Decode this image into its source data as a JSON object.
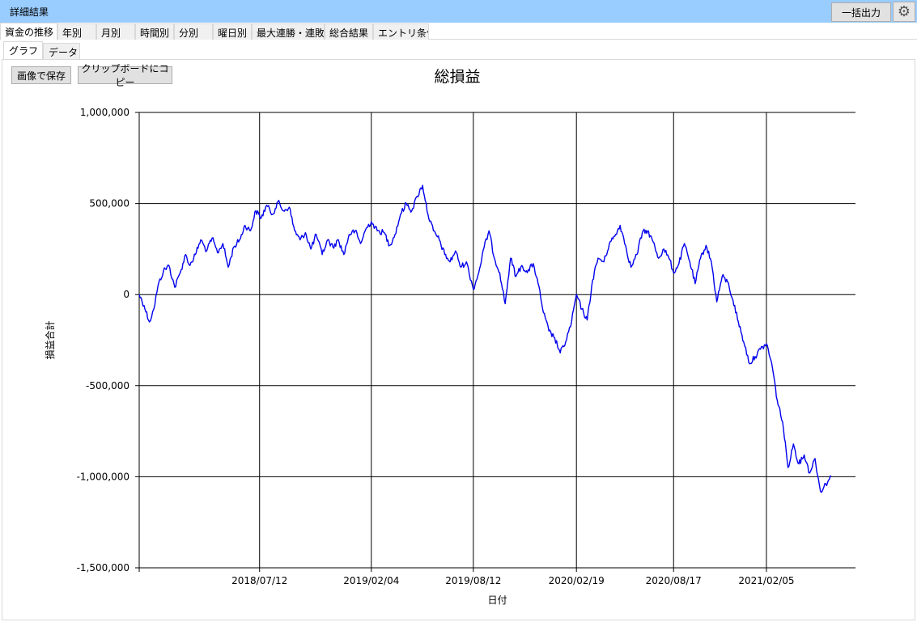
{
  "window": {
    "title": "詳細結果"
  },
  "toolbar": {
    "export_label": "一括出力",
    "settings_icon": "gear-icon"
  },
  "tabs": [
    {
      "label": "資金の推移"
    },
    {
      "label": "年別"
    },
    {
      "label": "月別"
    },
    {
      "label": "時間別"
    },
    {
      "label": "分別"
    },
    {
      "label": "曜日別"
    },
    {
      "label": "最大連勝・連敗"
    },
    {
      "label": "総合結果"
    },
    {
      "label": "エントリ条件"
    }
  ],
  "subtabs": [
    {
      "label": "グラフ"
    },
    {
      "label": "データ"
    }
  ],
  "actions": {
    "save_label": "画像で保存",
    "copy_label": "クリップボードにコピー"
  },
  "colors": {
    "series": "#0000ee",
    "titlebar": "#99ccff"
  },
  "chart_data": {
    "type": "line",
    "title": "総損益",
    "xlabel": "日付",
    "ylabel": "損益合計",
    "ylim": [
      -1500000,
      1000000
    ],
    "yticks": [
      1000000,
      500000,
      0,
      -500000,
      -1000000,
      -1500000
    ],
    "ytick_labels": [
      "1,000,000",
      "500,000",
      "0",
      "-500,000",
      "-1,000,000",
      "-1,500,000"
    ],
    "xlim": [
      "2017-12-01",
      "2021-07-20"
    ],
    "xticks": [
      "2018-07-12",
      "2019-02-04",
      "2019-08-12",
      "2020-02-19",
      "2020-08-17",
      "2021-02-05"
    ],
    "xtick_labels": [
      "2018/07/12",
      "2019/02/04",
      "2019/08/12",
      "2020/02/19",
      "2020/08/17",
      "2021/02/05"
    ],
    "grid": true,
    "series": [
      {
        "points": [
          [
            "2017-12-01",
            0
          ],
          [
            "2017-12-10",
            -60000
          ],
          [
            "2017-12-20",
            -150000
          ],
          [
            "2017-12-28",
            -80000
          ],
          [
            "2018-01-05",
            50000
          ],
          [
            "2018-01-15",
            130000
          ],
          [
            "2018-01-25",
            160000
          ],
          [
            "2018-02-05",
            40000
          ],
          [
            "2018-02-15",
            120000
          ],
          [
            "2018-02-25",
            220000
          ],
          [
            "2018-03-05",
            160000
          ],
          [
            "2018-03-15",
            220000
          ],
          [
            "2018-03-25",
            300000
          ],
          [
            "2018-04-05",
            240000
          ],
          [
            "2018-04-15",
            310000
          ],
          [
            "2018-04-25",
            230000
          ],
          [
            "2018-05-05",
            280000
          ],
          [
            "2018-05-15",
            150000
          ],
          [
            "2018-05-25",
            260000
          ],
          [
            "2018-06-05",
            300000
          ],
          [
            "2018-06-15",
            380000
          ],
          [
            "2018-06-25",
            350000
          ],
          [
            "2018-07-05",
            460000
          ],
          [
            "2018-07-15",
            420000
          ],
          [
            "2018-07-25",
            490000
          ],
          [
            "2018-08-05",
            440000
          ],
          [
            "2018-08-15",
            510000
          ],
          [
            "2018-08-25",
            460000
          ],
          [
            "2018-09-05",
            480000
          ],
          [
            "2018-09-15",
            350000
          ],
          [
            "2018-09-25",
            300000
          ],
          [
            "2018-10-05",
            340000
          ],
          [
            "2018-10-15",
            250000
          ],
          [
            "2018-10-25",
            330000
          ],
          [
            "2018-11-05",
            220000
          ],
          [
            "2018-11-15",
            300000
          ],
          [
            "2018-11-25",
            260000
          ],
          [
            "2018-12-05",
            300000
          ],
          [
            "2018-12-15",
            220000
          ],
          [
            "2018-12-25",
            330000
          ],
          [
            "2019-01-05",
            350000
          ],
          [
            "2019-01-15",
            280000
          ],
          [
            "2019-01-25",
            360000
          ],
          [
            "2019-02-04",
            400000
          ],
          [
            "2019-02-15",
            350000
          ],
          [
            "2019-02-28",
            340000
          ],
          [
            "2019-03-10",
            270000
          ],
          [
            "2019-03-20",
            330000
          ],
          [
            "2019-03-30",
            440000
          ],
          [
            "2019-04-10",
            500000
          ],
          [
            "2019-04-20",
            460000
          ],
          [
            "2019-04-30",
            540000
          ],
          [
            "2019-05-10",
            600000
          ],
          [
            "2019-05-20",
            440000
          ],
          [
            "2019-05-30",
            350000
          ],
          [
            "2019-06-10",
            300000
          ],
          [
            "2019-06-20",
            220000
          ],
          [
            "2019-06-30",
            180000
          ],
          [
            "2019-07-10",
            240000
          ],
          [
            "2019-07-20",
            150000
          ],
          [
            "2019-07-30",
            180000
          ],
          [
            "2019-08-12",
            30000
          ],
          [
            "2019-08-22",
            120000
          ],
          [
            "2019-09-01",
            260000
          ],
          [
            "2019-09-10",
            350000
          ],
          [
            "2019-09-20",
            200000
          ],
          [
            "2019-09-30",
            120000
          ],
          [
            "2019-10-10",
            -50000
          ],
          [
            "2019-10-20",
            200000
          ],
          [
            "2019-10-30",
            100000
          ],
          [
            "2019-11-10",
            160000
          ],
          [
            "2019-11-20",
            120000
          ],
          [
            "2019-12-01",
            170000
          ],
          [
            "2019-12-10",
            60000
          ],
          [
            "2019-12-20",
            -100000
          ],
          [
            "2019-12-30",
            -200000
          ],
          [
            "2020-01-10",
            -240000
          ],
          [
            "2020-01-20",
            -320000
          ],
          [
            "2020-01-30",
            -260000
          ],
          [
            "2020-02-10",
            -150000
          ],
          [
            "2020-02-19",
            0
          ],
          [
            "2020-02-29",
            -80000
          ],
          [
            "2020-03-10",
            -140000
          ],
          [
            "2020-03-20",
            80000
          ],
          [
            "2020-03-30",
            200000
          ],
          [
            "2020-04-10",
            180000
          ],
          [
            "2020-04-20",
            280000
          ],
          [
            "2020-04-30",
            320000
          ],
          [
            "2020-05-10",
            380000
          ],
          [
            "2020-05-20",
            270000
          ],
          [
            "2020-05-30",
            150000
          ],
          [
            "2020-06-10",
            220000
          ],
          [
            "2020-06-20",
            340000
          ],
          [
            "2020-06-30",
            350000
          ],
          [
            "2020-07-10",
            290000
          ],
          [
            "2020-07-20",
            200000
          ],
          [
            "2020-07-30",
            250000
          ],
          [
            "2020-08-10",
            190000
          ],
          [
            "2020-08-17",
            120000
          ],
          [
            "2020-08-27",
            170000
          ],
          [
            "2020-09-06",
            280000
          ],
          [
            "2020-09-16",
            180000
          ],
          [
            "2020-09-26",
            60000
          ],
          [
            "2020-10-06",
            200000
          ],
          [
            "2020-10-16",
            270000
          ],
          [
            "2020-10-26",
            180000
          ],
          [
            "2020-11-05",
            -40000
          ],
          [
            "2020-11-15",
            100000
          ],
          [
            "2020-11-25",
            70000
          ],
          [
            "2020-12-05",
            -30000
          ],
          [
            "2020-12-15",
            -150000
          ],
          [
            "2020-12-25",
            -260000
          ],
          [
            "2021-01-05",
            -380000
          ],
          [
            "2021-01-15",
            -340000
          ],
          [
            "2021-01-25",
            -300000
          ],
          [
            "2021-02-05",
            -270000
          ],
          [
            "2021-02-15",
            -380000
          ],
          [
            "2021-02-25",
            -580000
          ],
          [
            "2021-03-07",
            -700000
          ],
          [
            "2021-03-17",
            -950000
          ],
          [
            "2021-03-27",
            -820000
          ],
          [
            "2021-04-06",
            -930000
          ],
          [
            "2021-04-16",
            -880000
          ],
          [
            "2021-04-26",
            -980000
          ],
          [
            "2021-05-06",
            -900000
          ],
          [
            "2021-05-16",
            -1080000
          ],
          [
            "2021-05-26",
            -1040000
          ],
          [
            "2021-06-05",
            -1000000
          ]
        ]
      }
    ]
  }
}
